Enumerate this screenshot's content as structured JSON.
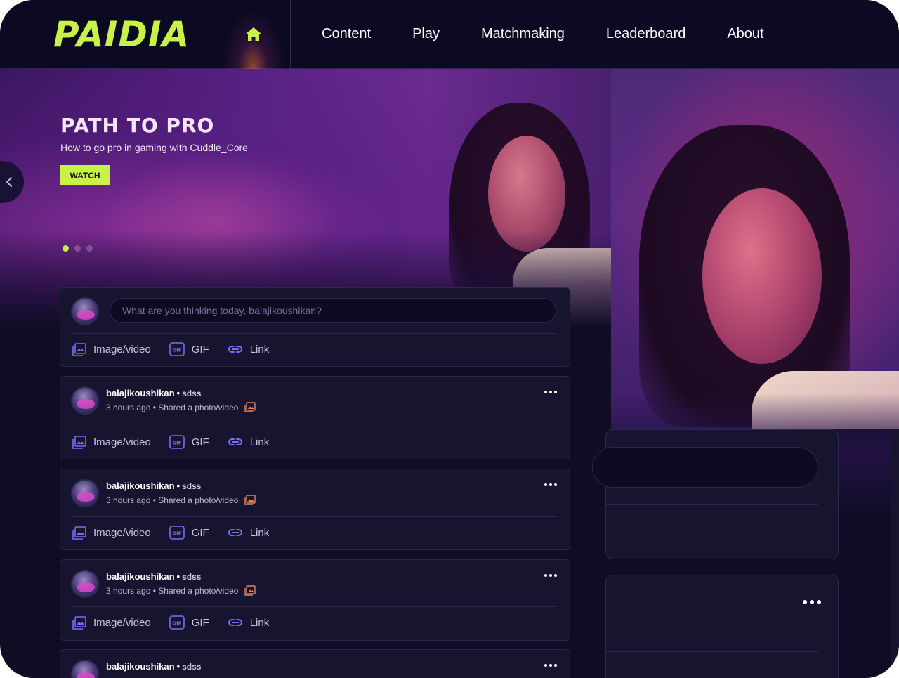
{
  "brand": {
    "logo": "PAIDIA",
    "accent_color": "#c8f24a"
  },
  "nav": {
    "home_icon": "home-icon",
    "links": [
      "Content",
      "Play",
      "Matchmaking",
      "Leaderboard",
      "About"
    ]
  },
  "hero": {
    "title": "PATH TO PRO",
    "subtitle": "How to go pro in gaming with Cuddle_Core",
    "button": "WATCH",
    "slide_count": 3,
    "active_slide": 1
  },
  "composer": {
    "placeholder": "What are you thinking today, balajikoushikan?",
    "actions": [
      "Image/video",
      "GIF",
      "Link"
    ]
  },
  "posts": [
    {
      "author": "balajikoushikan",
      "group": "sdss",
      "time": "3 hours ago",
      "activity": "Shared a photo/video",
      "actions": [
        "Image/video",
        "GIF",
        "Link"
      ]
    },
    {
      "author": "balajikoushikan",
      "group": "sdss",
      "time": "3 hours ago",
      "activity": "Shared a photo/video",
      "actions": [
        "Image/video",
        "GIF",
        "Link"
      ]
    },
    {
      "author": "balajikoushikan",
      "group": "sdss",
      "time": "3 hours ago",
      "activity": "Shared a photo/video",
      "actions": [
        "Image/video",
        "GIF",
        "Link"
      ]
    },
    {
      "author": "balajikoushikan",
      "group": "sdss",
      "time": "",
      "activity": "",
      "actions": []
    }
  ]
}
